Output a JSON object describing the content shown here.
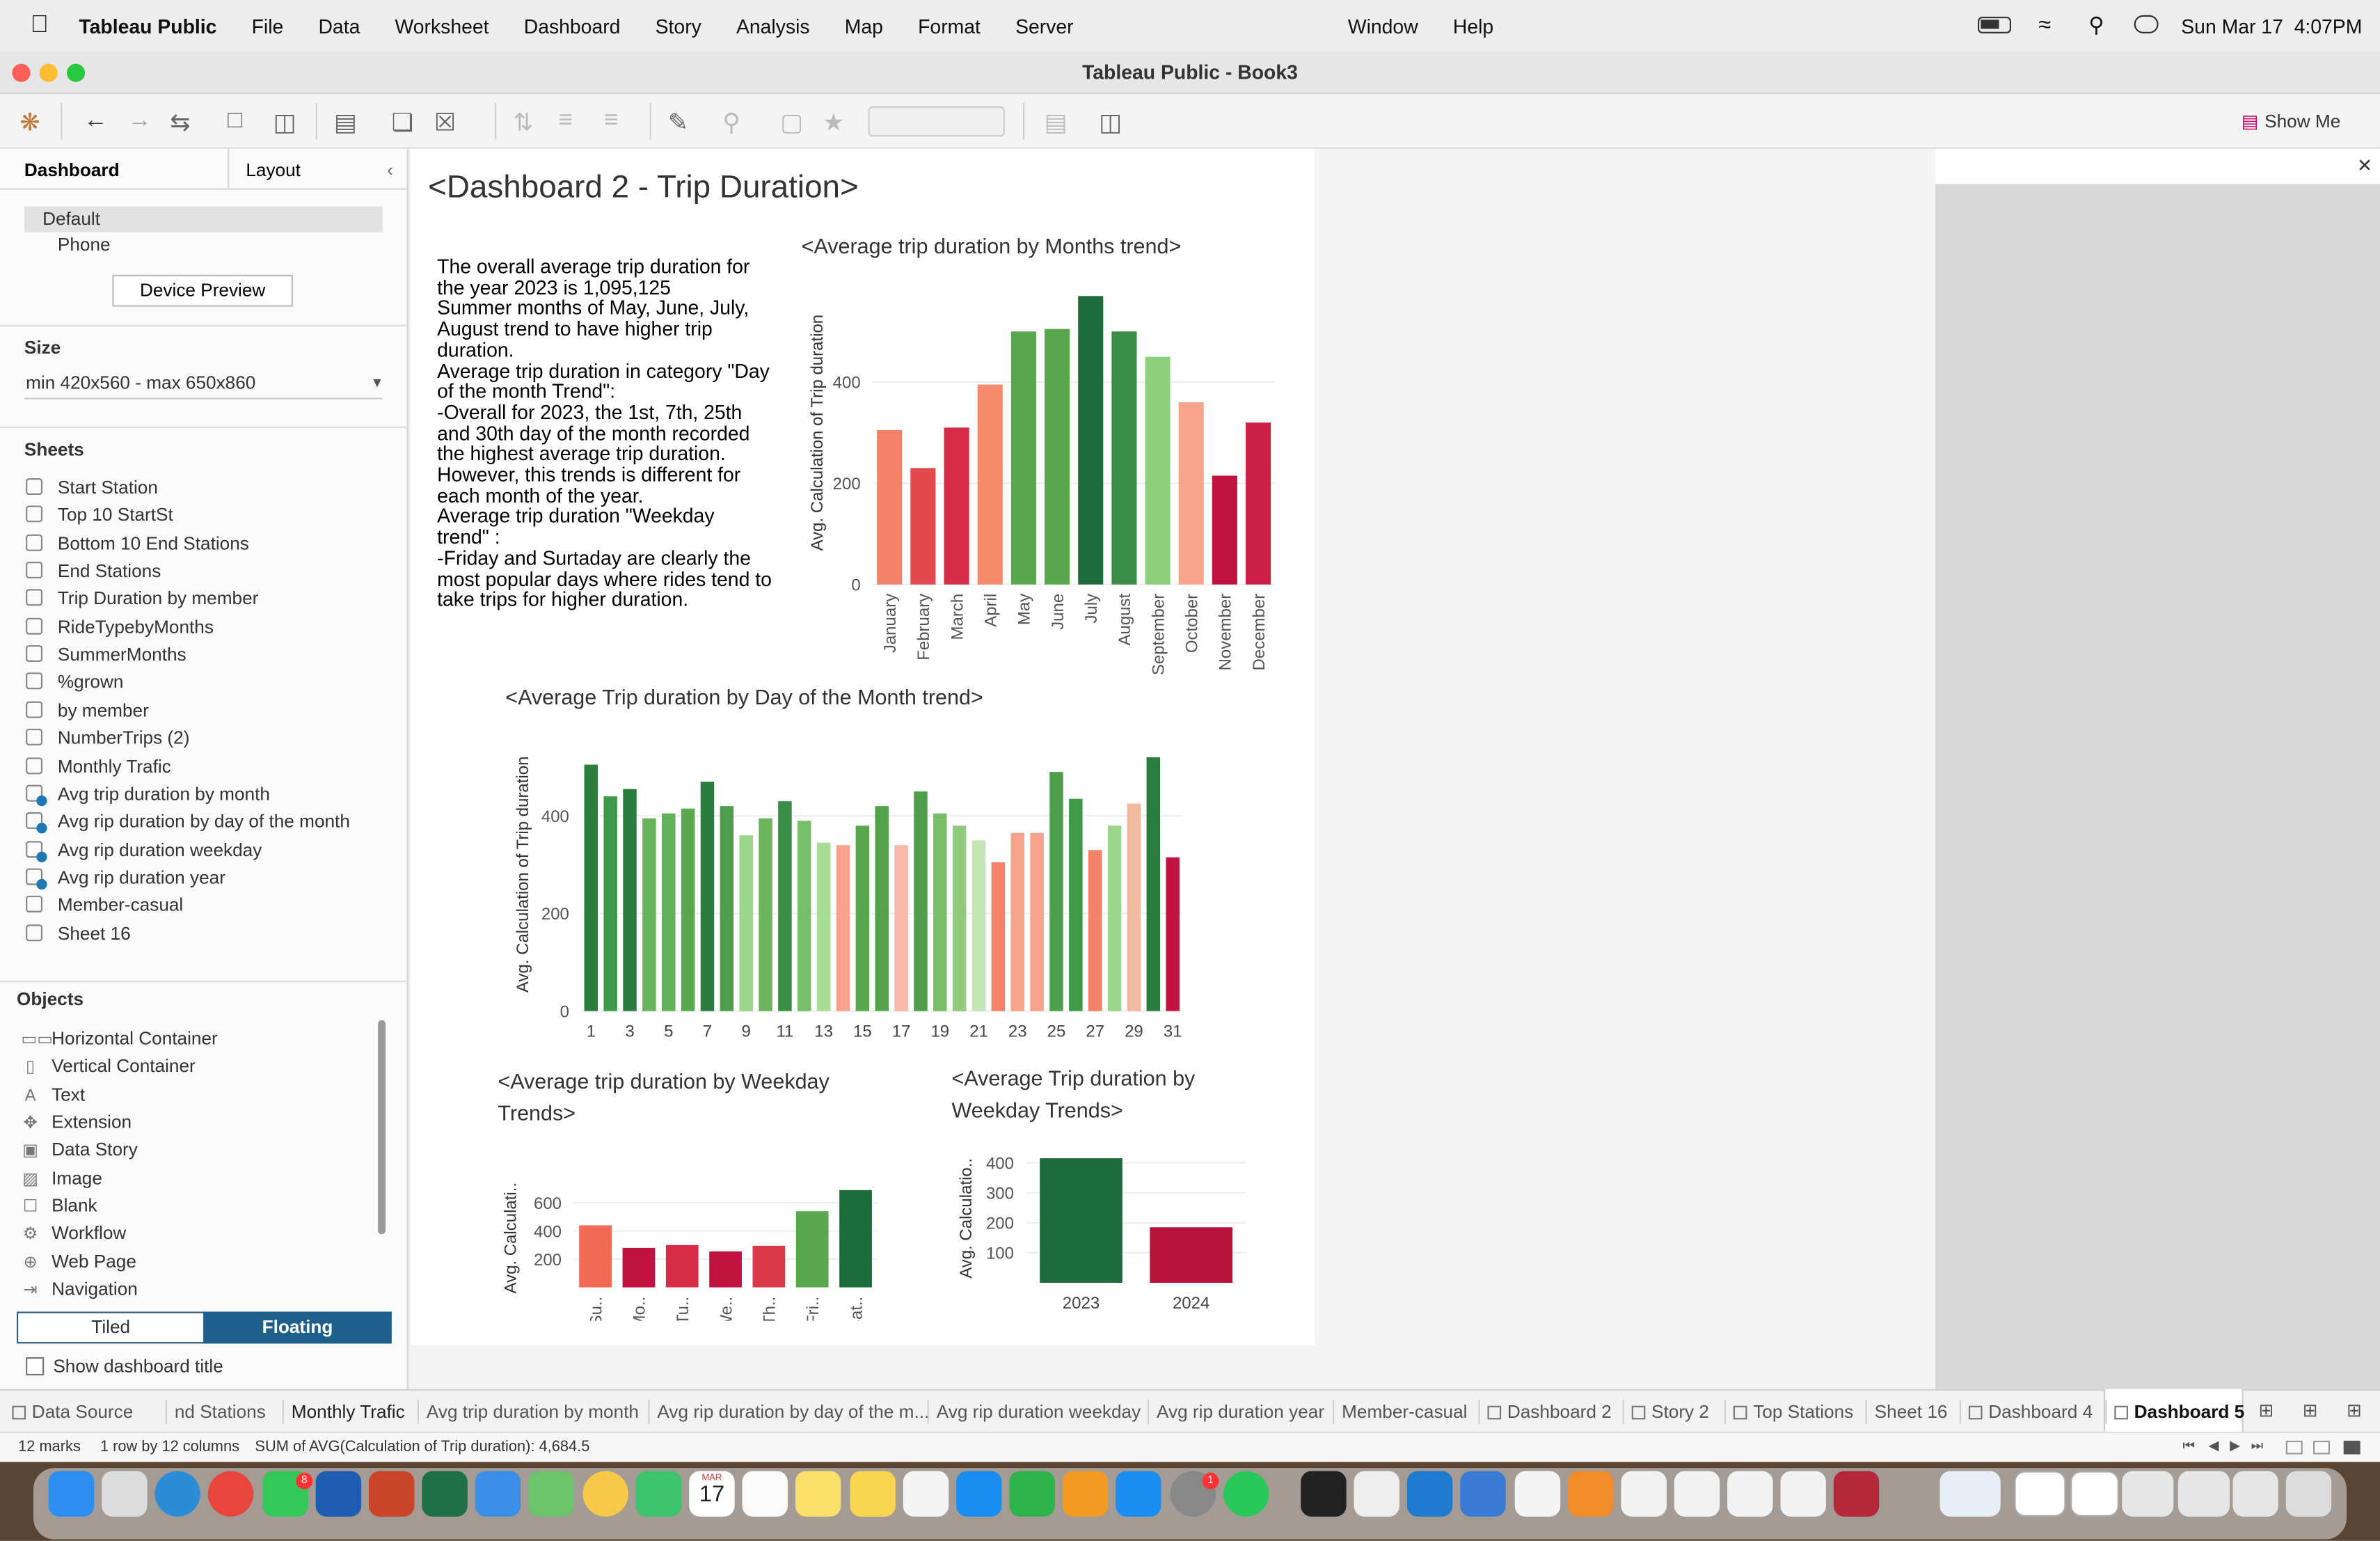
{
  "menubar": {
    "app": "Tableau Public",
    "items": [
      "File",
      "Data",
      "Worksheet",
      "Dashboard",
      "Story",
      "Analysis",
      "Map",
      "Format",
      "Server"
    ],
    "right_items": [
      "Window",
      "Help"
    ],
    "datetime": "Sun Mar 17  4:07PM"
  },
  "window": {
    "title": "Tableau Public - Book3"
  },
  "toolbar": {
    "show_me": "Show Me"
  },
  "left_panel": {
    "tab_dashboard": "Dashboard",
    "tab_layout": "Layout",
    "devices": [
      "Default",
      "Phone"
    ],
    "device_preview": "Device Preview",
    "size_label": "Size",
    "size_value": "min 420x560 - max 650x860",
    "sheets_label": "Sheets",
    "sheets": [
      {
        "name": "Start Station",
        "in_use": false
      },
      {
        "name": "Top 10 StartSt",
        "in_use": false
      },
      {
        "name": "Bottom 10 End Stations",
        "in_use": false
      },
      {
        "name": "End Stations",
        "in_use": false
      },
      {
        "name": "Trip Duration by member",
        "in_use": false
      },
      {
        "name": "RideTypebyMonths",
        "in_use": false
      },
      {
        "name": "SummerMonths",
        "in_use": false
      },
      {
        "name": "%grown",
        "in_use": false
      },
      {
        "name": "by member",
        "in_use": false
      },
      {
        "name": "NumberTrips (2)",
        "in_use": false
      },
      {
        "name": "Monthly Trafic",
        "in_use": false
      },
      {
        "name": "Avg trip duration by month",
        "in_use": true
      },
      {
        "name": "Avg rip duration by day of the month",
        "in_use": true
      },
      {
        "name": "Avg rip duration weekday",
        "in_use": true
      },
      {
        "name": "Avg rip duration year",
        "in_use": true
      },
      {
        "name": "Member-casual",
        "in_use": false
      },
      {
        "name": "Sheet 16",
        "in_use": false
      }
    ],
    "objects_label": "Objects",
    "objects": [
      {
        "name": "Horizontal Container",
        "icon": "horizontal-container-icon",
        "glyph": "▭▭"
      },
      {
        "name": "Vertical Container",
        "icon": "vertical-container-icon",
        "glyph": "▯"
      },
      {
        "name": "Text",
        "icon": "text-icon",
        "glyph": "A"
      },
      {
        "name": "Extension",
        "icon": "extension-icon",
        "glyph": "✥"
      },
      {
        "name": "Data Story",
        "icon": "data-story-icon",
        "glyph": "▣"
      },
      {
        "name": "Image",
        "icon": "image-icon",
        "glyph": "▨"
      },
      {
        "name": "Blank",
        "icon": "blank-icon",
        "glyph": "☐"
      },
      {
        "name": "Workflow",
        "icon": "workflow-icon",
        "glyph": "⚙"
      },
      {
        "name": "Web Page",
        "icon": "web-page-icon",
        "glyph": "⊕"
      },
      {
        "name": "Navigation",
        "icon": "navigation-icon",
        "glyph": "⇥"
      }
    ],
    "tiled": "Tiled",
    "floating": "Floating",
    "show_title": "Show dashboard title"
  },
  "dashboard": {
    "title": "<Dashboard 2 - Trip Duration>",
    "text_lines": [
      "The overall average trip duration for",
      "the year 2023 is 1,095,125",
      "Summer months of May, June, July,",
      "August trend to have higher trip",
      "duration.",
      "Average trip duration in category \"Day",
      "of the month Trend\":",
      "-Overall for 2023, the 1st, 7th, 25th",
      "and 30th day of the month recorded",
      "the highest average trip duration.",
      "However, this trends is different for",
      "each month of the year.",
      "Average trip duration \"Weekday",
      "trend\" :",
      "-Friday and Surtaday are clearly the",
      "most popular days where rides tend to",
      "take trips for higher duration."
    ]
  },
  "chart_data": [
    {
      "type": "bar",
      "title": "<Average trip duration by Months trend>",
      "ylabel": "Avg. Calculation of Trip duration",
      "ylim": [
        0,
        600
      ],
      "yticks": [
        0,
        200,
        400
      ],
      "categories": [
        "January",
        "February",
        "March",
        "April",
        "May",
        "June",
        "July",
        "August",
        "September",
        "October",
        "November",
        "December"
      ],
      "values": [
        305,
        230,
        310,
        395,
        500,
        505,
        570,
        500,
        450,
        360,
        215,
        320
      ],
      "colors": [
        "#f4826b",
        "#e24a4d",
        "#d62e48",
        "#f78a6d",
        "#5aa84e",
        "#5aa84e",
        "#1e6b3c",
        "#3b8c46",
        "#8fd07d",
        "#f7a28a",
        "#c0133f",
        "#cc1f47"
      ]
    },
    {
      "type": "bar",
      "title": "<Average Trip duration by Day of the Month trend>",
      "ylabel": "Avg. Calculation of Trip duration",
      "ylim": [
        0,
        560
      ],
      "yticks": [
        0,
        200,
        400
      ],
      "categories": [
        "1",
        "2",
        "3",
        "4",
        "5",
        "6",
        "7",
        "8",
        "9",
        "10",
        "11",
        "12",
        "13",
        "14",
        "15",
        "16",
        "17",
        "18",
        "19",
        "20",
        "21",
        "22",
        "23",
        "24",
        "25",
        "26",
        "27",
        "28",
        "29",
        "30",
        "31"
      ],
      "xticks": [
        "1",
        "3",
        "5",
        "7",
        "9",
        "11",
        "13",
        "15",
        "17",
        "19",
        "21",
        "23",
        "25",
        "27",
        "29",
        "31"
      ],
      "values": [
        505,
        440,
        455,
        395,
        405,
        415,
        470,
        420,
        360,
        395,
        430,
        390,
        345,
        340,
        380,
        420,
        340,
        450,
        405,
        380,
        350,
        305,
        365,
        365,
        490,
        435,
        330,
        380,
        425,
        520,
        315
      ],
      "colors": [
        "#2a7d3f",
        "#3f9a47",
        "#2a7d3f",
        "#68b45a",
        "#62b057",
        "#5aa84e",
        "#2a7d3f",
        "#4f9e4b",
        "#9cd68a",
        "#6bb55d",
        "#3b8c46",
        "#78bd67",
        "#a8dc95",
        "#f7a28a",
        "#5aa84e",
        "#52a34c",
        "#f7b8a8",
        "#4f9e4b",
        "#78bd67",
        "#8ecb7c",
        "#c4e6b5",
        "#f4826b",
        "#f7a28a",
        "#f7a28a",
        "#4f9e4b",
        "#3f9a47",
        "#f4826b",
        "#9cd68a",
        "#f2b8a0",
        "#2a7d3f",
        "#c0133f"
      ]
    },
    {
      "type": "bar",
      "title": "<Average trip duration by Weekday Trends>",
      "ylabel": "Avg. Calculati..",
      "ylim": [
        0,
        700
      ],
      "yticks": [
        200,
        400,
        600
      ],
      "categories": [
        "Su..",
        "Mo..",
        "Tu..",
        "We..",
        "Th..",
        "Fri..",
        "Sat.."
      ],
      "values": [
        440,
        280,
        300,
        255,
        295,
        540,
        690
      ],
      "colors": [
        "#f16a55",
        "#c0133f",
        "#d62e48",
        "#c0133f",
        "#d93a4a",
        "#5aa84e",
        "#1e6b3c"
      ]
    },
    {
      "type": "bar",
      "title": "<Average Trip duration by Weekday Trends>",
      "ylabel": "Avg. Calculatio..",
      "ylim": [
        0,
        430
      ],
      "yticks": [
        100,
        200,
        300,
        400
      ],
      "categories": [
        "2023",
        "2024"
      ],
      "values": [
        415,
        185
      ],
      "colors": [
        "#1e6b3c",
        "#b5133b"
      ]
    }
  ],
  "bottom_tabs": [
    "Data Source",
    "nd Stations",
    "Monthly Trafic",
    "Avg trip duration by month",
    "Avg rip duration by day of the m...",
    "Avg rip duration weekday",
    "Avg rip duration year",
    "Member-casual",
    "Dashboard 2",
    "Story 2",
    "Top Stations",
    "Sheet 16",
    "Dashboard 4",
    "Dashboard 5"
  ],
  "active_tab": "Dashboard 5",
  "status": {
    "marks": "12 marks",
    "rows": "1 row by 12 columns",
    "sum": "SUM of AVG(Calculation of Trip duration): 4,684.5"
  },
  "dock": {
    "calendar_month": "MAR",
    "calendar_day": "17",
    "messages_badge": "8",
    "settings_badge": "1"
  }
}
